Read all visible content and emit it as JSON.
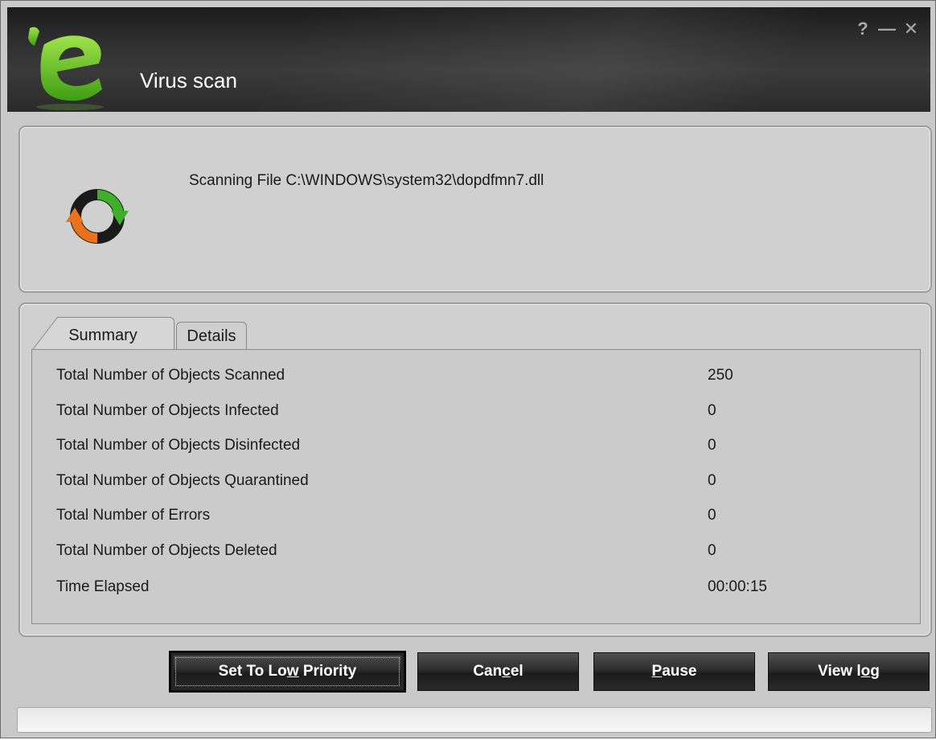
{
  "window": {
    "title": "Virus scan",
    "controls": {
      "help": "?",
      "minimize": "—",
      "close": "✕"
    }
  },
  "scan": {
    "status_text": "Scanning File C:\\WINDOWS\\system32\\dopdfmn7.dll"
  },
  "tabs": [
    {
      "label": "Summary",
      "active": true
    },
    {
      "label": "Details",
      "active": false
    }
  ],
  "summary": {
    "rows": [
      {
        "label": "Total Number of Objects Scanned",
        "value": "250"
      },
      {
        "label": "Total Number of Objects Infected",
        "value": "0"
      },
      {
        "label": "Total Number of Objects Disinfected",
        "value": "0"
      },
      {
        "label": "Total Number of Objects Quarantined",
        "value": "0"
      },
      {
        "label": "Total Number of Errors",
        "value": "0"
      },
      {
        "label": "Total Number of Objects Deleted",
        "value": "0"
      },
      {
        "label": "Time Elapsed",
        "value": "00:00:15"
      }
    ]
  },
  "buttons": {
    "low_priority": {
      "pre": "Set To Lo",
      "accel": "w",
      "post": " Priority"
    },
    "cancel": {
      "pre": "Can",
      "accel": "c",
      "post": "el"
    },
    "pause": {
      "pre": "",
      "accel": "P",
      "post": "ause"
    },
    "view_log": {
      "pre": "View l",
      "accel": "o",
      "post": "g"
    }
  },
  "progress": {
    "fraction": 0.0
  },
  "colors": {
    "logo_green": "#5fbf22",
    "icon_orange": "#e8731c",
    "icon_green": "#3fae2a",
    "titlebar": "#2a2a2a"
  },
  "icons": {
    "logo": "e-logo-icon",
    "scan": "refresh-scan-icon"
  }
}
